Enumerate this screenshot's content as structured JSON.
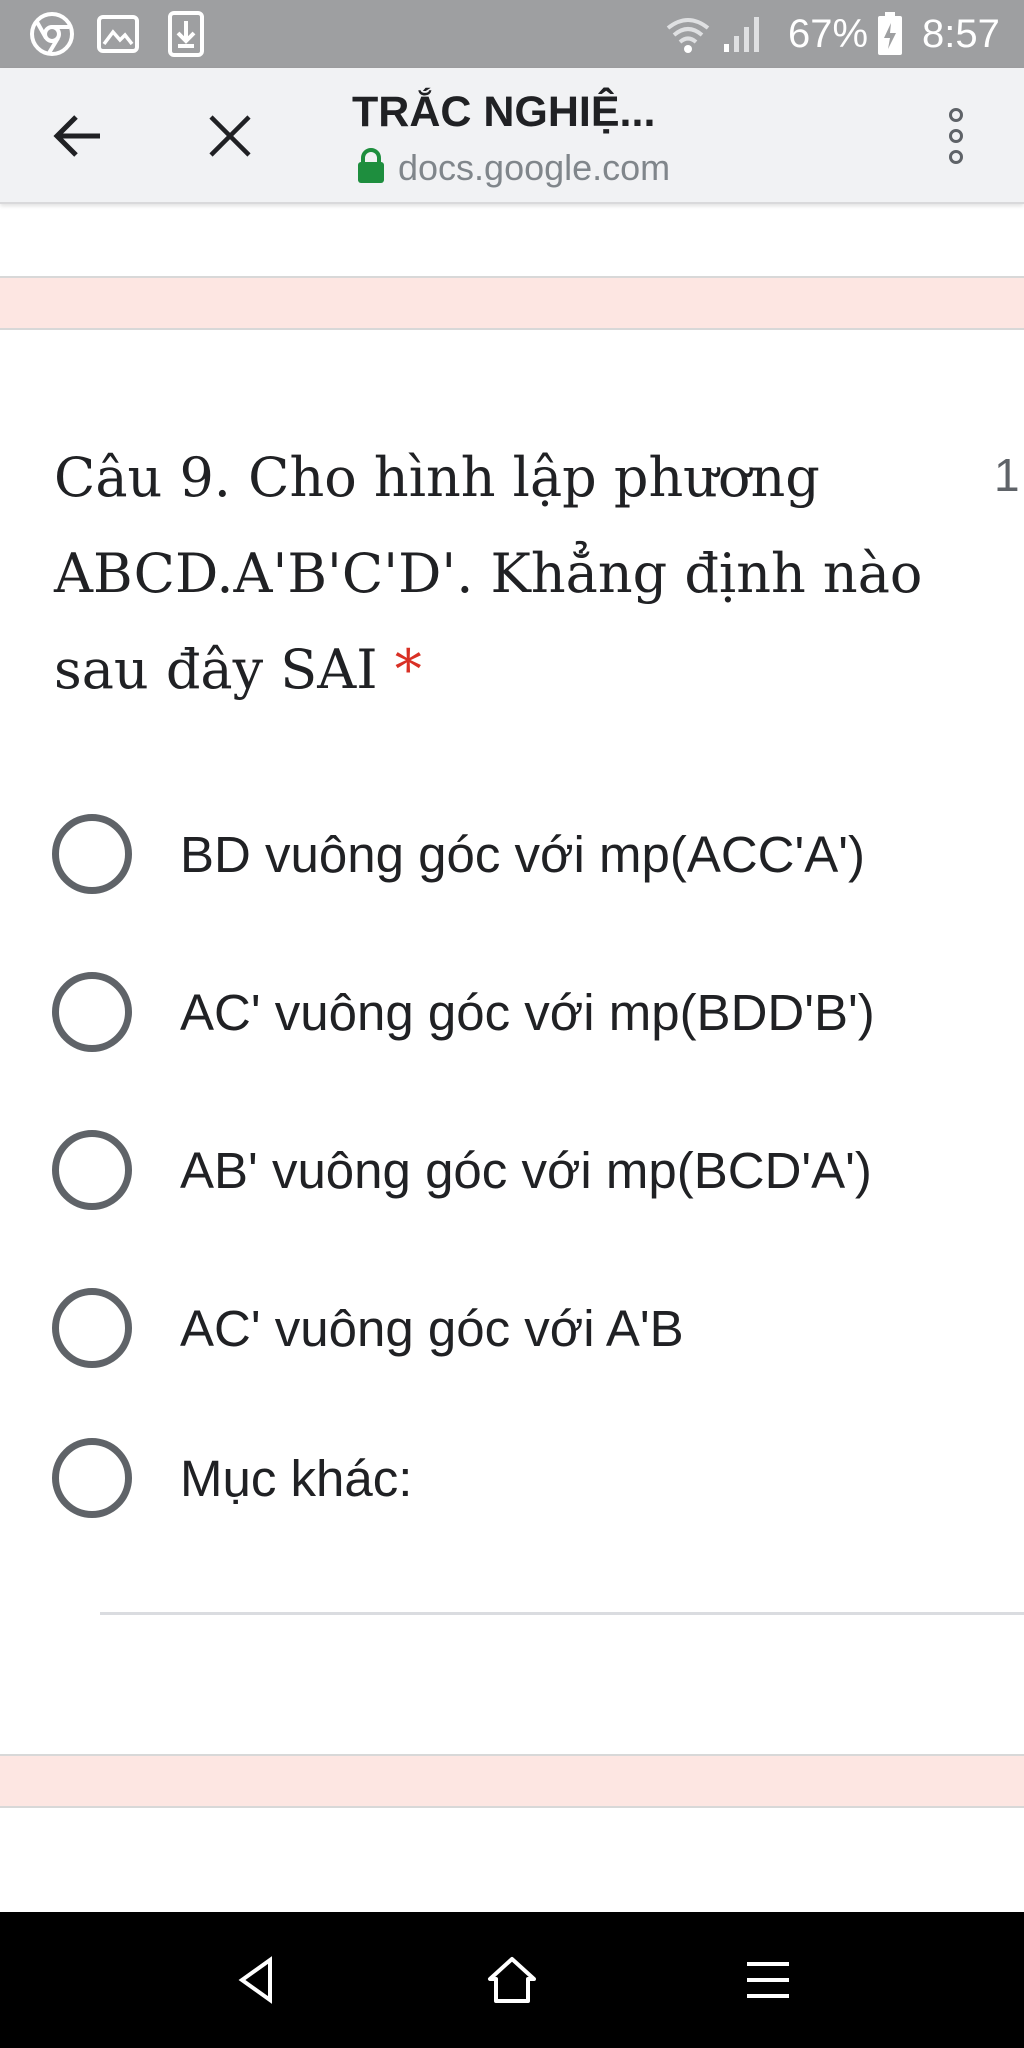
{
  "status_bar": {
    "battery_percent": "67%",
    "time": "8:57",
    "icons": [
      "chrome-icon",
      "gallery-icon",
      "download-icon",
      "wifi-icon",
      "signal-icon",
      "battery-charging-icon"
    ]
  },
  "toolbar": {
    "back_icon": "back-arrow-icon",
    "close_icon": "close-icon",
    "title": "TRẮC NGHIỆ...",
    "url": "docs.google.com",
    "menu_icon": "more-vert-icon",
    "lock_color": "#1e8e3e"
  },
  "question": {
    "text": "Câu 9. Cho hình lập phương ABCD.A'B'C'D'. Khẳng định nào sau đây SAI",
    "required_mark": "*",
    "points": "1"
  },
  "options": [
    {
      "label": "BD vuông góc với mp(ACC'A')"
    },
    {
      "label": "AC' vuông góc với mp(BDD'B')"
    },
    {
      "label": "AB' vuông góc với mp(BCD'A')"
    },
    {
      "label": "AC' vuông góc với A'B"
    },
    {
      "label": "Mục khác:"
    }
  ],
  "navbar": {
    "icons": [
      "nav-back-icon",
      "nav-home-icon",
      "nav-menu-icon"
    ]
  },
  "colors": {
    "accent_band": "#fde6e2",
    "required": "#d93025",
    "radio_border": "#5f6368"
  }
}
